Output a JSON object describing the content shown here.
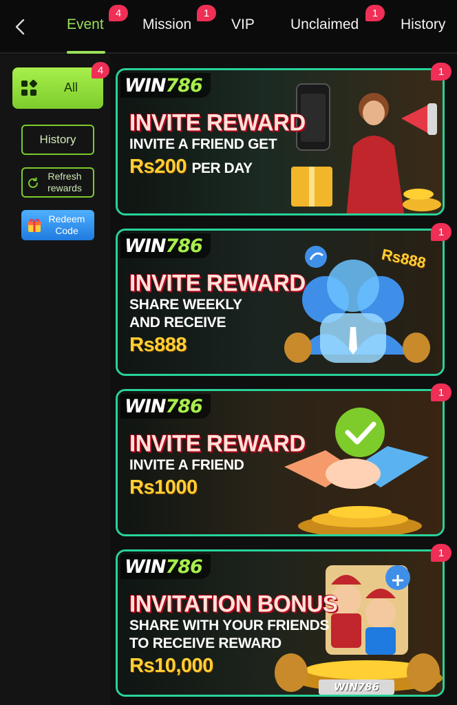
{
  "tabs": [
    {
      "label": "Event",
      "badge": "4",
      "active": true
    },
    {
      "label": "Mission",
      "badge": "1"
    },
    {
      "label": "VIP"
    },
    {
      "label": "Unclaimed",
      "badge": "1"
    },
    {
      "label": "History"
    }
  ],
  "sidebar": {
    "all_label": "All",
    "all_badge": "4",
    "history_label": "History",
    "refresh_label": "Refresh rewards",
    "redeem_label": "Redeem Code"
  },
  "cards": [
    {
      "brand_a": "WIN",
      "brand_b": "786",
      "headline": "INVITE REWARD",
      "line1": "INVITE A FRIEND GET",
      "line2": "",
      "amount": "Rs200",
      "amount_suffix": "PER DAY",
      "badge": "1",
      "art": "woman-megaphone-gift"
    },
    {
      "brand_a": "WIN",
      "brand_b": "786",
      "headline": "INVITE REWARD",
      "line1": "SHARE WEEKLY",
      "line2": "AND RECEIVE",
      "amount": "Rs888",
      "amount_suffix": "",
      "corner_text": "Rs888",
      "badge": "1",
      "art": "share-users-money-bags"
    },
    {
      "brand_a": "WIN",
      "brand_b": "786",
      "headline": "INVITE REWARD",
      "line1": "INVITE A FRIEND",
      "line2": "",
      "amount": "Rs1000",
      "amount_suffix": "",
      "badge": "1",
      "art": "handshake-check-coins"
    },
    {
      "brand_a": "WIN",
      "brand_b": "786",
      "headline": "INVITATION BONUS",
      "line1": "SHARE WITH YOUR FRIENDS",
      "line2": "TO RECEIVE REWARD",
      "amount": "Rs10,000",
      "amount_suffix": "",
      "footer_brand": "WIN786",
      "badge": "1",
      "art": "fortune-gods-coins"
    }
  ],
  "colors": {
    "accent": "#9be05a",
    "badge": "#ef2f55",
    "card_border": "#28d39a",
    "amount": "#ffcf33"
  }
}
